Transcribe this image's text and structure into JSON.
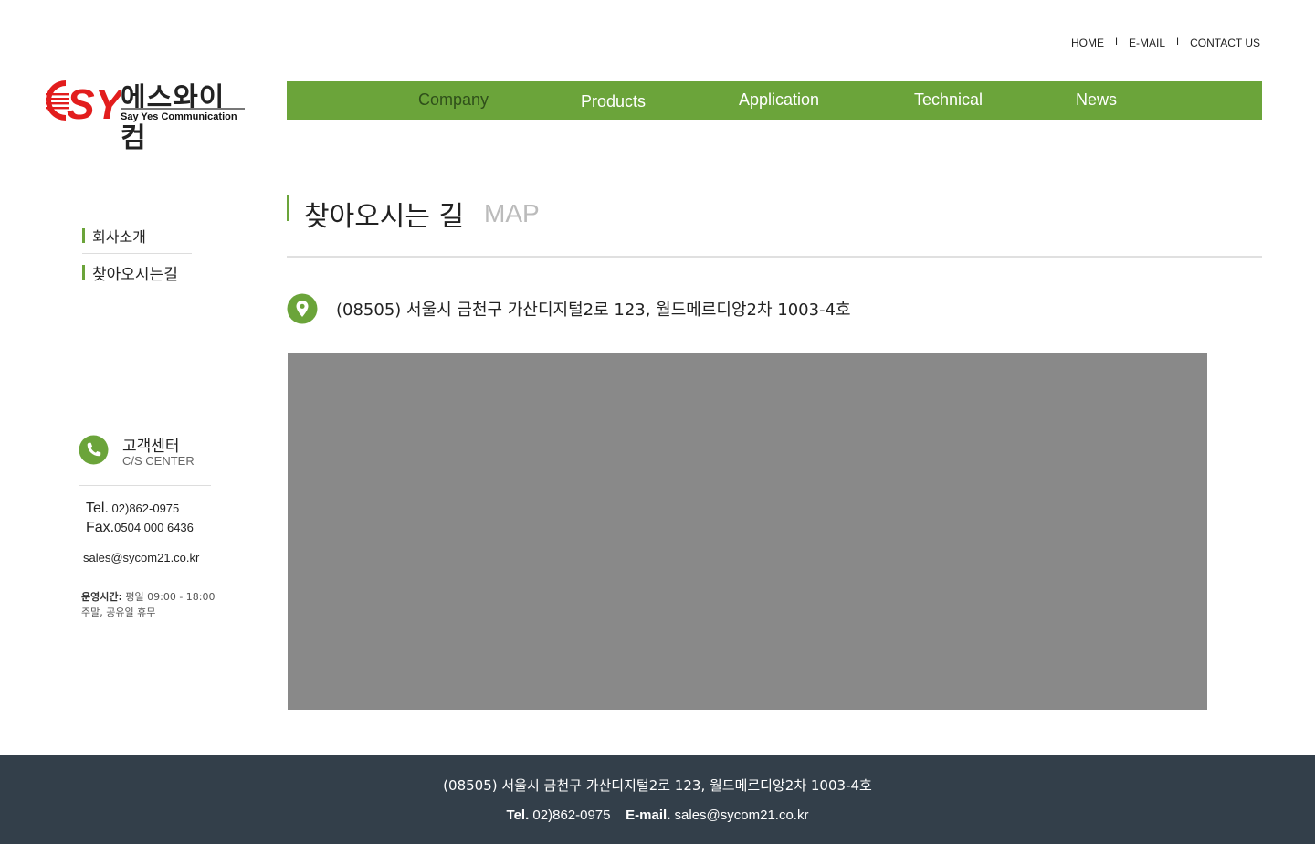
{
  "util_nav": {
    "home": "HOME",
    "email": "E-MAIL",
    "contact": "CONTACT US",
    "separator": "I"
  },
  "logo": {
    "mark": "SY",
    "korean": "에스와이컴",
    "english": "Say Yes Communication",
    "colors": {
      "mark": "#e21d1d",
      "stripes": "#e21d1d"
    }
  },
  "gnb": {
    "items": [
      {
        "label": "Company",
        "active": true
      },
      {
        "label": "Products",
        "active": false
      },
      {
        "label": "Application",
        "active": false
      },
      {
        "label": "Technical",
        "active": false
      },
      {
        "label": "News",
        "active": false
      }
    ],
    "colors": {
      "background": "#6ba43a",
      "text": "#ffffff",
      "active_text": "#2f4f1a"
    }
  },
  "sidebar": {
    "items": [
      {
        "label": "회사소개"
      },
      {
        "label": "찾아오시는길",
        "active": true
      }
    ]
  },
  "cs_center": {
    "title": "고객센터",
    "subtitle": "C/S CENTER",
    "tel_label": "Tel.",
    "tel": "02)862-0975",
    "fax_label": "Fax.",
    "fax": "0504 000 6436",
    "email": "sales@sycom21.co.kr",
    "hours_label": "운영시간:",
    "hours": "평일 09:00 - 18:00",
    "holidays": "주말, 공유일 휴무",
    "icon": "phone-icon"
  },
  "page_header": {
    "title": "찾아오시는 길",
    "subtitle": "MAP"
  },
  "address": {
    "icon": "location-pin-icon",
    "text": "(08505) 서울시 금천구 가산디지털2로 123, 월드메르디앙2차 1003-4호"
  },
  "footer": {
    "address": "(08505) 서울시 금천구 가산디지털2로 123, 월드메르디앙2차 1003-4호",
    "tel_label": "Tel.",
    "tel": "02)862-0975",
    "email_label": "E-mail.",
    "email": "sales@sycom21.co.kr",
    "colors": {
      "background": "#333f4a",
      "text": "#ffffff"
    }
  },
  "colors": {
    "accent": "#6ba43a",
    "map_placeholder": "#898989"
  }
}
